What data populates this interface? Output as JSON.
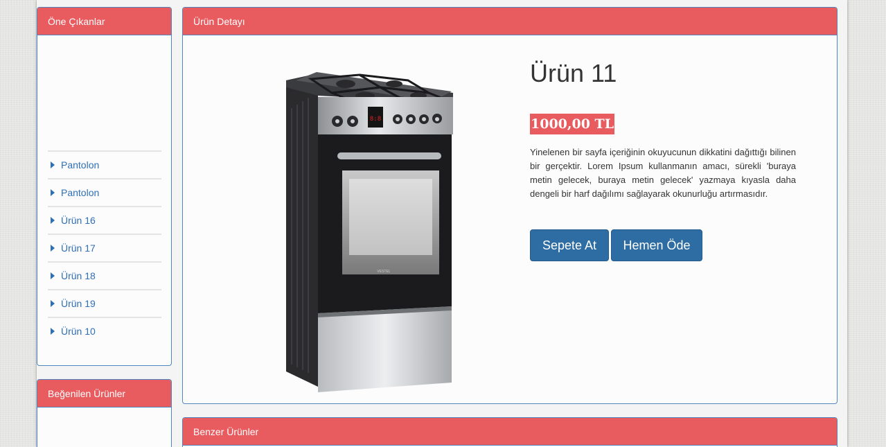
{
  "sidebar": {
    "featured": {
      "title": "Öne Çıkanlar",
      "items": [
        {
          "label": "Pantolon"
        },
        {
          "label": "Pantolon"
        },
        {
          "label": "Ürün 16"
        },
        {
          "label": "Ürün 17"
        },
        {
          "label": "Ürün 18"
        },
        {
          "label": "Ürün 19"
        },
        {
          "label": "Ürün 10"
        }
      ]
    },
    "liked": {
      "title": "Beğenilen Ürünler"
    }
  },
  "detail": {
    "title": "Ürün Detayı",
    "product": {
      "name": "Ürün 11",
      "price": "1000,00 TL",
      "description": "Yinelenen bir sayfa içeriğinin okuyucunun dikkatini dağıttığı bilinen bir gerçektir. Lorem Ipsum kullanmanın amacı, sürekli 'buraya metin gelecek, buraya metin gelecek' yazmaya kıyasla daha dengeli bir harf dağılımı sağlayarak okunurluğu artırmasıdır.",
      "image_brand": "VESTEL",
      "image_display": "8:8"
    },
    "buttons": {
      "add_to_cart": "Sepete At",
      "buy_now": "Hemen Öde"
    }
  },
  "similar": {
    "title": "Benzer Ürünler"
  },
  "colors": {
    "panel_heading": "#e85b5f",
    "panel_border": "#4e86c0",
    "button": "#2e6da4",
    "link": "#2d6fb8"
  }
}
